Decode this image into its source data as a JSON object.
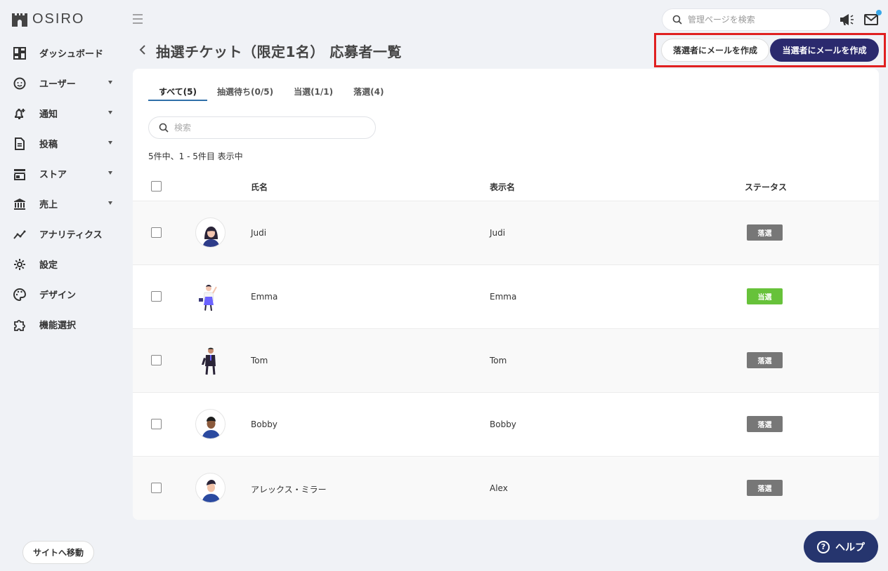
{
  "brand": {
    "name": "OSIRO"
  },
  "sidebar": {
    "items": [
      {
        "label": "ダッシュボード",
        "icon": "dashboard-icon",
        "has_caret": false
      },
      {
        "label": "ユーザー",
        "icon": "user-face-icon",
        "has_caret": true
      },
      {
        "label": "通知",
        "icon": "bell-plus-icon",
        "has_caret": true
      },
      {
        "label": "投稿",
        "icon": "document-icon",
        "has_caret": true
      },
      {
        "label": "ストア",
        "icon": "store-icon",
        "has_caret": true
      },
      {
        "label": "売上",
        "icon": "bank-icon",
        "has_caret": true
      },
      {
        "label": "アナリティクス",
        "icon": "analytics-icon",
        "has_caret": false
      },
      {
        "label": "設定",
        "icon": "gear-icon",
        "has_caret": false
      },
      {
        "label": "デザイン",
        "icon": "palette-icon",
        "has_caret": false
      },
      {
        "label": "機能選択",
        "icon": "puzzle-icon",
        "has_caret": false
      }
    ],
    "site_button": "サイトへ移動"
  },
  "topbar": {
    "search_placeholder": "管理ページを検索"
  },
  "header": {
    "title": "抽選チケット（限定1名） 応募者一覧",
    "btn_losers": "落選者にメールを作成",
    "btn_winners": "当選者にメールを作成"
  },
  "tabs": [
    {
      "label": "すべて(5)",
      "active": true
    },
    {
      "label": "抽選待ち(0/5)",
      "active": false
    },
    {
      "label": "当選(1/1)",
      "active": false
    },
    {
      "label": "落選(4)",
      "active": false
    }
  ],
  "list": {
    "search_placeholder": "検索",
    "count_text": "5件中、1 - 5件目 表示中",
    "columns": {
      "name": "氏名",
      "display_name": "表示名",
      "status": "ステータス"
    },
    "rows": [
      {
        "name": "Judi",
        "display_name": "Judi",
        "status": "落選",
        "status_type": "lose"
      },
      {
        "name": "Emma",
        "display_name": "Emma",
        "status": "当選",
        "status_type": "win"
      },
      {
        "name": "Tom",
        "display_name": "Tom",
        "status": "落選",
        "status_type": "lose"
      },
      {
        "name": "Bobby",
        "display_name": "Bobby",
        "status": "落選",
        "status_type": "lose"
      },
      {
        "name": "アレックス・ミラー",
        "display_name": "Alex",
        "status": "落選",
        "status_type": "lose"
      }
    ]
  },
  "help": {
    "label": "ヘルプ"
  },
  "colors": {
    "primary_dark": "#2b2a6e",
    "help_navy": "#26356e",
    "win_green": "#67c23a",
    "lose_gray": "#777777",
    "highlight_red": "#e02020",
    "notif_blue": "#3aa8e8"
  }
}
